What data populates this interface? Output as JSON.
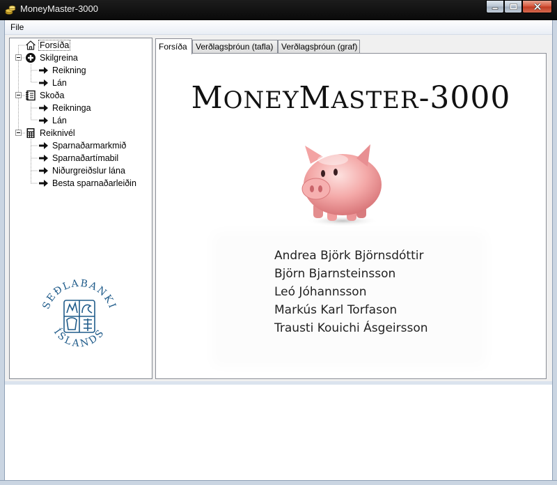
{
  "window": {
    "title": "MoneyMaster-3000"
  },
  "menu": {
    "file_label": "File"
  },
  "tree": {
    "items": [
      {
        "label": "Forsíða",
        "icon": "home-icon",
        "selected": true
      },
      {
        "label": "Skilgreina",
        "icon": "plus-circle-icon"
      },
      {
        "label": "Reikning",
        "icon": "arrow-right-icon"
      },
      {
        "label": "Lán",
        "icon": "arrow-right-icon"
      },
      {
        "label": "Skoða",
        "icon": "notebook-icon"
      },
      {
        "label": "Reikninga",
        "icon": "arrow-right-icon"
      },
      {
        "label": "Lán",
        "icon": "arrow-right-icon"
      },
      {
        "label": "Reiknivél",
        "icon": "calculator-icon"
      },
      {
        "label": "Sparnaðarmarkmið",
        "icon": "arrow-right-icon"
      },
      {
        "label": "Sparnaðartímabil",
        "icon": "arrow-right-icon"
      },
      {
        "label": "Niðurgreiðslur lána",
        "icon": "arrow-right-icon"
      },
      {
        "label": "Besta sparnaðarleiðin",
        "icon": "arrow-right-icon"
      }
    ]
  },
  "seal": {
    "top_text": "SEÐLABANKI",
    "bottom_text": "ÍSLANDS"
  },
  "tabs": [
    {
      "label": "Forsíða",
      "active": true
    },
    {
      "label": "Verðlagsþróun (tafla)"
    },
    {
      "label": "Verðlagsþróun (graf)"
    }
  ],
  "home": {
    "title_parts": [
      "M",
      "ONEY",
      "M",
      "ASTER",
      "-3000"
    ],
    "names": [
      "Andrea Björk Björnsdóttir",
      "Björn Bjarnsteinsson",
      "Leó Jóhannsson",
      "Markús Karl Torfason",
      "Trausti Kouichi Ásgeirsson"
    ]
  },
  "colors": {
    "seal_blue": "#1f5b8a",
    "pig_pink": "#f4a9a8",
    "titlebar": "#111111"
  }
}
